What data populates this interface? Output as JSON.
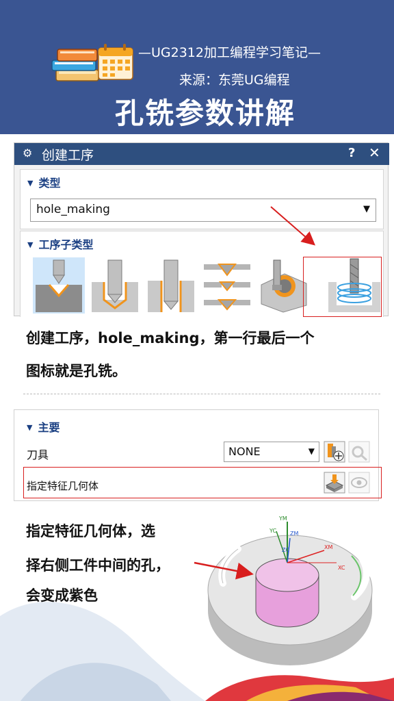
{
  "header": {
    "subtitle": "—UG2312加工编程学习笔记—",
    "source": "来源：东莞UG编程",
    "title": "孔铣参数讲解",
    "logo_icons": [
      "books-icon",
      "calendar-icon"
    ]
  },
  "dialog": {
    "title": "创建工序",
    "help": "?",
    "close": "✕",
    "type_section": {
      "label": "类型",
      "value": "hole_making"
    },
    "subtype_section": {
      "label": "工序子类型"
    }
  },
  "captions": {
    "caption1_line1": "创建工序，hole_making，第一行最后一个",
    "caption1_line2": "图标就是孔铣。",
    "caption2_line1": "指定特征几何体，选",
    "caption2_line2": "择右侧工件中间的孔，",
    "caption2_line3": "会变成紫色"
  },
  "panel": {
    "section_label": "主要",
    "tool_label": "刀具",
    "tool_value": "NONE",
    "feature_label": "指定特征几何体"
  },
  "axes": {
    "ym": "YM",
    "yc": "YC",
    "zm": "ZM",
    "zc": "ZC",
    "xm": "XM",
    "xc": "XC"
  },
  "colors": {
    "header_bg": "#3a5592",
    "dialog_title_bg": "#2e4f7f",
    "highlight": "#d81e1e",
    "hole_fill": "#e7a0dc",
    "section_text": "#1a3f82"
  }
}
